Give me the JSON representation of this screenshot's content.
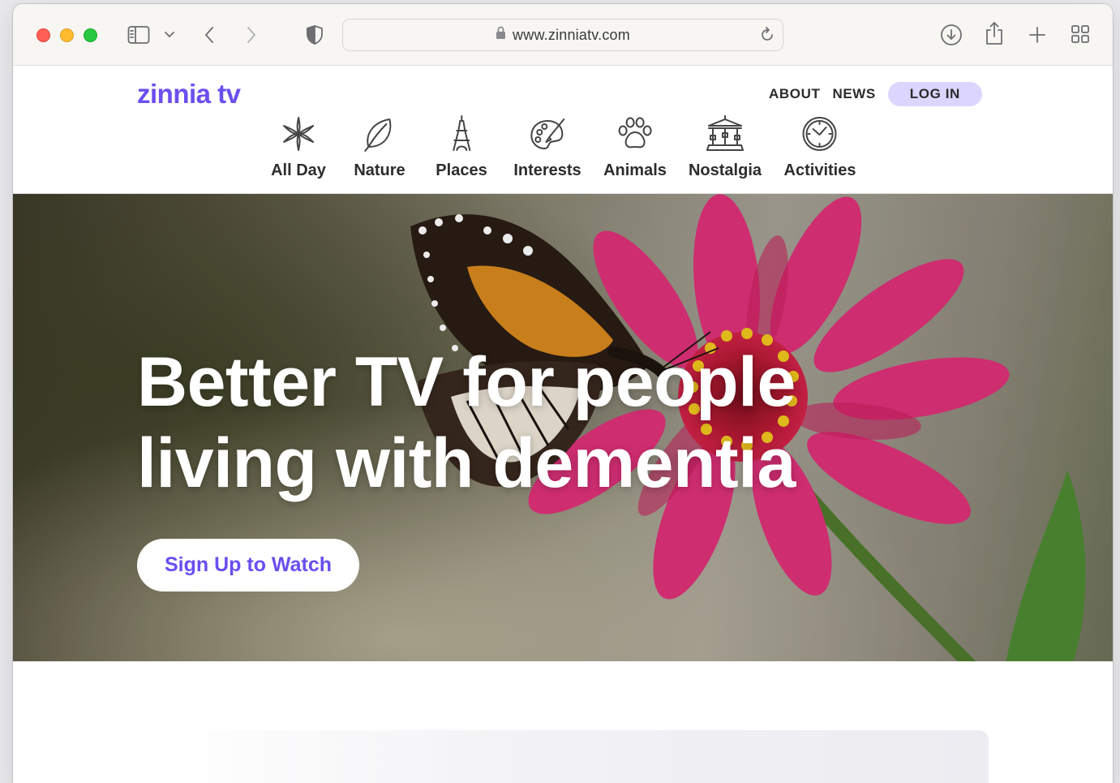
{
  "browser": {
    "url": "www.zinniatv.com",
    "icons": [
      "sidebar-icon",
      "chevron-down-icon",
      "back-icon",
      "forward-icon",
      "shield-icon",
      "lock-icon",
      "reload-icon",
      "download-icon",
      "share-icon",
      "new-tab-icon",
      "tab-overview-icon"
    ]
  },
  "site": {
    "logo": "zinnia tv",
    "brand_color": "#6b4ef0",
    "nav": {
      "about": "ABOUT",
      "news": "NEWS",
      "login": "LOG IN"
    },
    "categories": [
      {
        "label": "All Day",
        "icon": "sparkle-icon"
      },
      {
        "label": "Nature",
        "icon": "leaf-icon"
      },
      {
        "label": "Places",
        "icon": "eiffel-tower-icon"
      },
      {
        "label": "Interests",
        "icon": "palette-icon"
      },
      {
        "label": "Animals",
        "icon": "paw-icon"
      },
      {
        "label": "Nostalgia",
        "icon": "carousel-icon"
      },
      {
        "label": "Activities",
        "icon": "clock-icon"
      }
    ]
  },
  "hero": {
    "title_line1": "Better TV for people",
    "title_line2": "living with dementia",
    "cta": "Sign Up to Watch",
    "image": "butterfly-on-pink-zinnia"
  }
}
